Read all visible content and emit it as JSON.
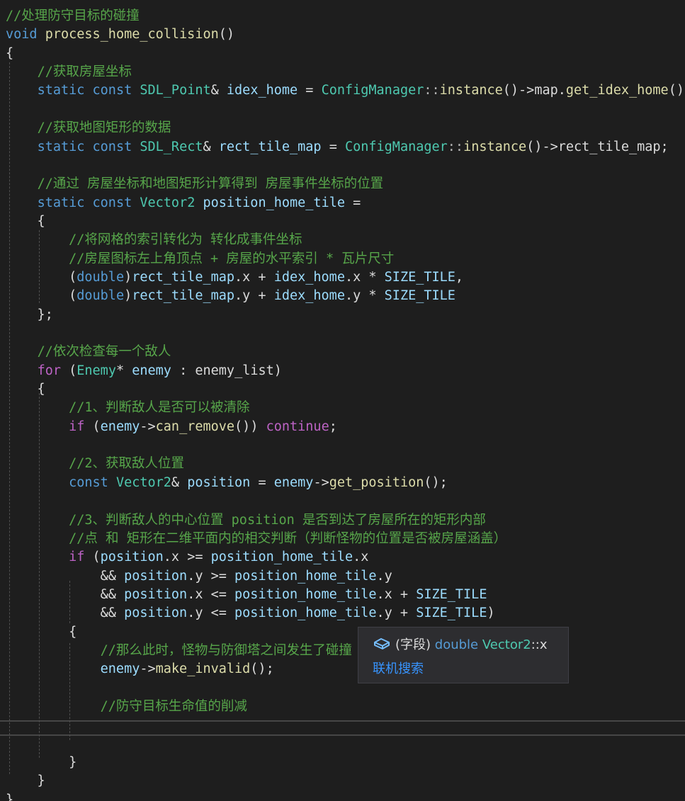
{
  "code": {
    "lines": [
      [
        {
          "t": "//处理防守目标的碰撞",
          "c": "c"
        }
      ],
      [
        {
          "t": "void",
          "c": "kw"
        },
        {
          "t": " ",
          "c": "pl"
        },
        {
          "t": "process_home_collision",
          "c": "fn"
        },
        {
          "t": "()",
          "c": "pl"
        }
      ],
      [
        {
          "t": "{",
          "c": "pl"
        }
      ],
      [
        {
          "t": "    ",
          "c": "pl"
        },
        {
          "t": "//获取房屋坐标",
          "c": "c"
        }
      ],
      [
        {
          "t": "    ",
          "c": "pl"
        },
        {
          "t": "static",
          "c": "kw"
        },
        {
          "t": " ",
          "c": "pl"
        },
        {
          "t": "const",
          "c": "kw"
        },
        {
          "t": " ",
          "c": "pl"
        },
        {
          "t": "SDL_Point",
          "c": "ty"
        },
        {
          "t": "& ",
          "c": "pl"
        },
        {
          "t": "idex_home",
          "c": "vr"
        },
        {
          "t": " = ",
          "c": "pl"
        },
        {
          "t": "ConfigManager",
          "c": "ty"
        },
        {
          "t": "::",
          "c": "op"
        },
        {
          "t": "instance",
          "c": "fn"
        },
        {
          "t": "()->",
          "c": "pl"
        },
        {
          "t": "map",
          "c": "mb"
        },
        {
          "t": ".",
          "c": "pl"
        },
        {
          "t": "get_idex_home",
          "c": "fn"
        },
        {
          "t": "();",
          "c": "pl"
        }
      ],
      [],
      [
        {
          "t": "    ",
          "c": "pl"
        },
        {
          "t": "//获取地图矩形的数据",
          "c": "c"
        }
      ],
      [
        {
          "t": "    ",
          "c": "pl"
        },
        {
          "t": "static",
          "c": "kw"
        },
        {
          "t": " ",
          "c": "pl"
        },
        {
          "t": "const",
          "c": "kw"
        },
        {
          "t": " ",
          "c": "pl"
        },
        {
          "t": "SDL_Rect",
          "c": "ty"
        },
        {
          "t": "& ",
          "c": "pl"
        },
        {
          "t": "rect_tile_map",
          "c": "vr"
        },
        {
          "t": " = ",
          "c": "pl"
        },
        {
          "t": "ConfigManager",
          "c": "ty"
        },
        {
          "t": "::",
          "c": "op"
        },
        {
          "t": "instance",
          "c": "fn"
        },
        {
          "t": "()->",
          "c": "pl"
        },
        {
          "t": "rect_tile_map",
          "c": "mb"
        },
        {
          "t": ";",
          "c": "pl"
        }
      ],
      [],
      [
        {
          "t": "    ",
          "c": "pl"
        },
        {
          "t": "//通过 房屋坐标和地图矩形计算得到 房屋事件坐标的位置",
          "c": "c"
        }
      ],
      [
        {
          "t": "    ",
          "c": "pl"
        },
        {
          "t": "static",
          "c": "kw"
        },
        {
          "t": " ",
          "c": "pl"
        },
        {
          "t": "const",
          "c": "kw"
        },
        {
          "t": " ",
          "c": "pl"
        },
        {
          "t": "Vector2",
          "c": "ty"
        },
        {
          "t": " ",
          "c": "pl"
        },
        {
          "t": "position_home_tile",
          "c": "vr"
        },
        {
          "t": " =",
          "c": "pl"
        }
      ],
      [
        {
          "t": "    {",
          "c": "pl"
        }
      ],
      [
        {
          "t": "        ",
          "c": "pl"
        },
        {
          "t": "//将网格的索引转化为 转化成事件坐标",
          "c": "c"
        }
      ],
      [
        {
          "t": "        ",
          "c": "pl"
        },
        {
          "t": "//房屋图标左上角顶点 + 房屋的水平索引 * 瓦片尺寸",
          "c": "c"
        }
      ],
      [
        {
          "t": "        (",
          "c": "pl"
        },
        {
          "t": "double",
          "c": "kw"
        },
        {
          "t": ")",
          "c": "pl"
        },
        {
          "t": "rect_tile_map",
          "c": "vr"
        },
        {
          "t": ".",
          "c": "pl"
        },
        {
          "t": "x",
          "c": "mb"
        },
        {
          "t": " + ",
          "c": "pl"
        },
        {
          "t": "idex_home",
          "c": "vr"
        },
        {
          "t": ".",
          "c": "pl"
        },
        {
          "t": "x",
          "c": "mb"
        },
        {
          "t": " * ",
          "c": "pl"
        },
        {
          "t": "SIZE_TILE",
          "c": "vr"
        },
        {
          "t": ",",
          "c": "pl"
        }
      ],
      [
        {
          "t": "        (",
          "c": "pl"
        },
        {
          "t": "double",
          "c": "kw"
        },
        {
          "t": ")",
          "c": "pl"
        },
        {
          "t": "rect_tile_map",
          "c": "vr"
        },
        {
          "t": ".",
          "c": "pl"
        },
        {
          "t": "y",
          "c": "mb"
        },
        {
          "t": " + ",
          "c": "pl"
        },
        {
          "t": "idex_home",
          "c": "vr"
        },
        {
          "t": ".",
          "c": "pl"
        },
        {
          "t": "y",
          "c": "mb"
        },
        {
          "t": " * ",
          "c": "pl"
        },
        {
          "t": "SIZE_TILE",
          "c": "vr"
        }
      ],
      [
        {
          "t": "    };",
          "c": "pl"
        }
      ],
      [],
      [
        {
          "t": "    ",
          "c": "pl"
        },
        {
          "t": "//依次检查每一个敌人",
          "c": "c"
        }
      ],
      [
        {
          "t": "    ",
          "c": "pl"
        },
        {
          "t": "for",
          "c": "mc"
        },
        {
          "t": " (",
          "c": "pl"
        },
        {
          "t": "Enemy",
          "c": "ty"
        },
        {
          "t": "* ",
          "c": "pl"
        },
        {
          "t": "enemy",
          "c": "vr"
        },
        {
          "t": " : ",
          "c": "pl"
        },
        {
          "t": "enemy_list",
          "c": "mb"
        },
        {
          "t": ")",
          "c": "pl"
        }
      ],
      [
        {
          "t": "    {",
          "c": "pl"
        }
      ],
      [
        {
          "t": "        ",
          "c": "pl"
        },
        {
          "t": "//1、判断敌人是否可以被清除",
          "c": "c"
        }
      ],
      [
        {
          "t": "        ",
          "c": "pl"
        },
        {
          "t": "if",
          "c": "mc"
        },
        {
          "t": " (",
          "c": "pl"
        },
        {
          "t": "enemy",
          "c": "vr"
        },
        {
          "t": "->",
          "c": "pl"
        },
        {
          "t": "can_remove",
          "c": "fn"
        },
        {
          "t": "()) ",
          "c": "pl"
        },
        {
          "t": "continue",
          "c": "mc"
        },
        {
          "t": ";",
          "c": "pl"
        }
      ],
      [],
      [
        {
          "t": "        ",
          "c": "pl"
        },
        {
          "t": "//2、获取敌人位置",
          "c": "c"
        }
      ],
      [
        {
          "t": "        ",
          "c": "pl"
        },
        {
          "t": "const",
          "c": "kw"
        },
        {
          "t": " ",
          "c": "pl"
        },
        {
          "t": "Vector2",
          "c": "ty"
        },
        {
          "t": "& ",
          "c": "pl"
        },
        {
          "t": "position",
          "c": "vr"
        },
        {
          "t": " = ",
          "c": "pl"
        },
        {
          "t": "enemy",
          "c": "vr"
        },
        {
          "t": "->",
          "c": "pl"
        },
        {
          "t": "get_position",
          "c": "fn"
        },
        {
          "t": "();",
          "c": "pl"
        }
      ],
      [],
      [
        {
          "t": "        ",
          "c": "pl"
        },
        {
          "t": "//3、判断敌人的中心位置 position 是否到达了房屋所在的矩形内部",
          "c": "c"
        }
      ],
      [
        {
          "t": "        ",
          "c": "pl"
        },
        {
          "t": "//点 和 矩形在二维平面内的相交判断（判断怪物的位置是否被房屋涵盖）",
          "c": "c"
        }
      ],
      [
        {
          "t": "        ",
          "c": "pl"
        },
        {
          "t": "if",
          "c": "mc"
        },
        {
          "t": " (",
          "c": "pl"
        },
        {
          "t": "position",
          "c": "vr"
        },
        {
          "t": ".",
          "c": "pl"
        },
        {
          "t": "x",
          "c": "mb"
        },
        {
          "t": " >= ",
          "c": "pl"
        },
        {
          "t": "position_home_tile",
          "c": "vr"
        },
        {
          "t": ".",
          "c": "pl"
        },
        {
          "t": "x",
          "c": "mb"
        }
      ],
      [
        {
          "t": "            && ",
          "c": "pl"
        },
        {
          "t": "position",
          "c": "vr"
        },
        {
          "t": ".",
          "c": "pl"
        },
        {
          "t": "y",
          "c": "mb"
        },
        {
          "t": " >= ",
          "c": "pl"
        },
        {
          "t": "position_home_tile",
          "c": "vr"
        },
        {
          "t": ".",
          "c": "pl"
        },
        {
          "t": "y",
          "c": "mb"
        }
      ],
      [
        {
          "t": "            && ",
          "c": "pl"
        },
        {
          "t": "position",
          "c": "vr"
        },
        {
          "t": ".",
          "c": "pl"
        },
        {
          "t": "x",
          "c": "mb"
        },
        {
          "t": " <= ",
          "c": "pl"
        },
        {
          "t": "position_home_tile",
          "c": "vr"
        },
        {
          "t": ".",
          "c": "pl"
        },
        {
          "t": "x",
          "c": "mb"
        },
        {
          "t": " + ",
          "c": "pl"
        },
        {
          "t": "SIZE_TILE",
          "c": "vr"
        }
      ],
      [
        {
          "t": "            && ",
          "c": "pl"
        },
        {
          "t": "position",
          "c": "vr"
        },
        {
          "t": ".",
          "c": "pl"
        },
        {
          "t": "y",
          "c": "mb"
        },
        {
          "t": " <= ",
          "c": "pl"
        },
        {
          "t": "position_home_tile",
          "c": "vr"
        },
        {
          "t": ".",
          "c": "pl"
        },
        {
          "t": "y",
          "c": "mb"
        },
        {
          "t": " + ",
          "c": "pl"
        },
        {
          "t": "SIZE_TILE",
          "c": "vr"
        },
        {
          "t": ")",
          "c": "pl"
        }
      ],
      [
        {
          "t": "        {",
          "c": "pl"
        }
      ],
      [
        {
          "t": "            ",
          "c": "pl"
        },
        {
          "t": "//那么此时，怪物与防御塔之间发生了碰撞",
          "c": "c"
        }
      ],
      [
        {
          "t": "            ",
          "c": "pl"
        },
        {
          "t": "enemy",
          "c": "vr"
        },
        {
          "t": "->",
          "c": "pl"
        },
        {
          "t": "make_invalid",
          "c": "fn"
        },
        {
          "t": "();",
          "c": "pl"
        }
      ],
      [],
      [
        {
          "t": "            ",
          "c": "pl"
        },
        {
          "t": "//防守目标生命值的削减",
          "c": "c"
        }
      ],
      [],
      [],
      [
        {
          "t": "        }",
          "c": "pl"
        }
      ],
      [
        {
          "t": "    }",
          "c": "pl"
        }
      ],
      [
        {
          "t": "}",
          "c": "pl"
        }
      ]
    ]
  },
  "tooltip": {
    "icon": "field-icon",
    "kind": "(字段)",
    "type_keyword": "double",
    "type_class": "Vector2",
    "scope_op": "::",
    "member": "x",
    "online_search": "联机搜索"
  },
  "colors": {
    "background": "#1e1e1e",
    "comment": "#57a64a",
    "keyword": "#569cd6",
    "control_keyword": "#d8a0df",
    "type": "#4ec9b0",
    "function": "#dcdcaa",
    "variable": "#9cdcfe",
    "link": "#3794ff"
  }
}
